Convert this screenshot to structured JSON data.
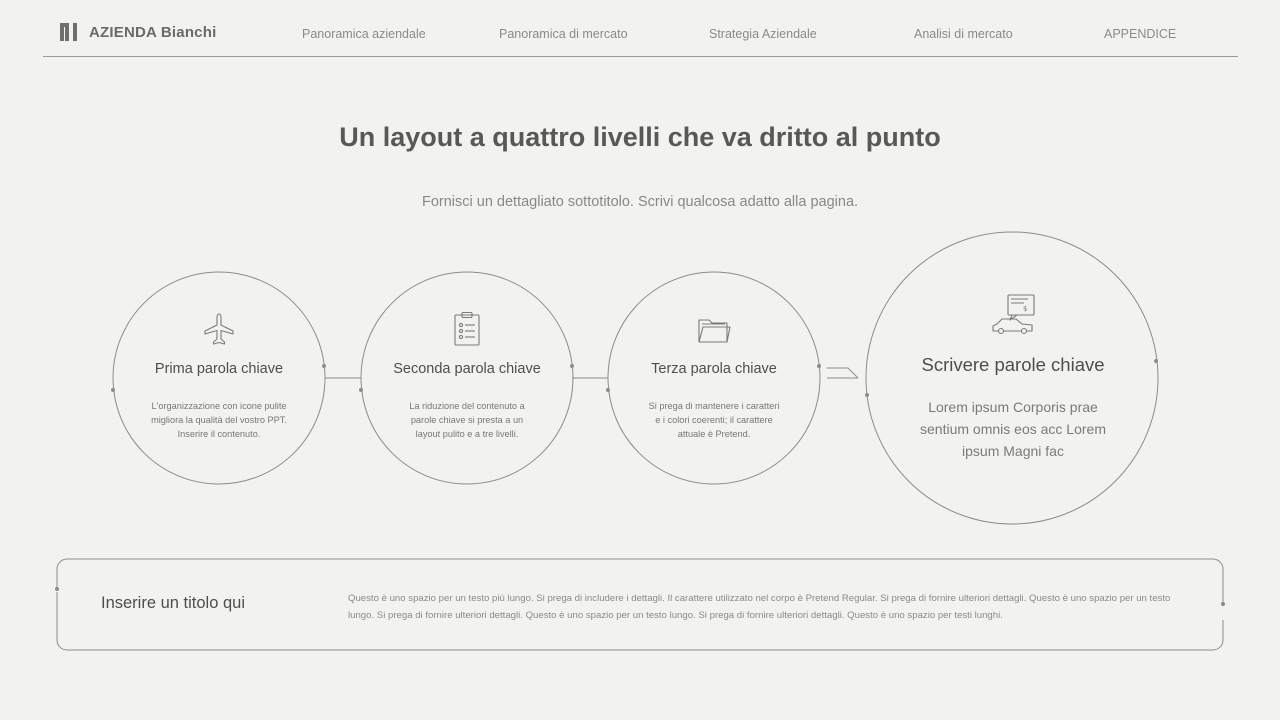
{
  "header": {
    "brand": "AZIENDA Bianchi",
    "nav": [
      "Panoramica aziendale",
      "Panoramica di mercato",
      "Strategia Aziendale",
      "Analisi di mercato",
      "APPENDICE"
    ]
  },
  "main": {
    "title": "Un layout a quattro livelli che va dritto al punto",
    "subtitle": "Fornisci un dettagliato sottotitolo. Scrivi qualcosa adatto alla pagina.",
    "steps": [
      {
        "icon": "airplane-icon",
        "keyword": "Prima parola chiave",
        "description": "L'organizzazione con icone pulite migliora la qualità del vostro PPT. Inserire il contenuto."
      },
      {
        "icon": "clipboard-checklist-icon",
        "keyword": "Seconda parola chiave",
        "description": "La riduzione del contenuto a parole chiave si presta a un layout pulito e a tre livelli."
      },
      {
        "icon": "folder-icon",
        "keyword": "Terza parola chiave",
        "description": "Si prega di mantenere i caratteri e i colori coerenti; il carattere attuale è Pretend."
      },
      {
        "icon": "car-invoice-icon",
        "keyword": "Scrivere parole chiave",
        "description": "Lorem ipsum Corporis prae sentium omnis eos acc Lorem ipsum Magni fac"
      }
    ],
    "bottom": {
      "title": "Inserire un titolo qui",
      "body": "Questo è uno spazio per un testo più lungo. Si prega di includere i dettagli. Il carattere utilizzato nel corpo è Pretend Regular. Si prega di fornire ulteriori dettagli. Questo è uno spazio per un testo lungo. Si prega di fornire ulteriori dettagli. Questo è uno spazio per un testo lungo. Si prega di fornire ulteriori dettagli. Questo è uno spazio per testi lunghi."
    }
  },
  "colors": {
    "background": "#f2f2ee",
    "line": "#8a8a88",
    "text": "#4e4e4c"
  }
}
